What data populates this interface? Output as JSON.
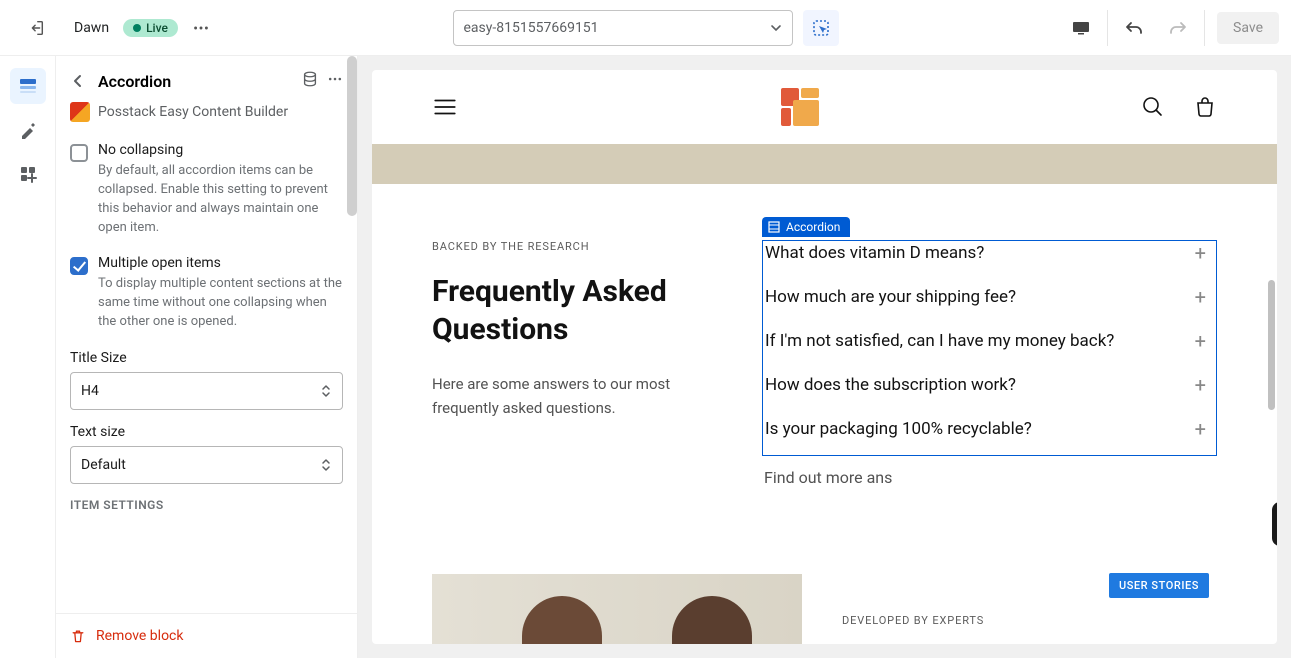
{
  "topbar": {
    "theme_name": "Dawn",
    "status_label": "Live",
    "template_name": "easy-8151557669151",
    "save_label": "Save"
  },
  "panel": {
    "title": "Accordion",
    "brand": "Posstack Easy Content Builder",
    "settings": {
      "no_collapsing": {
        "title": "No collapsing",
        "desc": "By default, all accordion items can be collapsed. Enable this setting to prevent this behavior and always maintain one open item.",
        "checked": false
      },
      "multiple_open": {
        "title": "Multiple open items",
        "desc": "To display multiple content sections at the same time without one collapsing when the other one is opened.",
        "checked": true
      },
      "title_size": {
        "label": "Title Size",
        "value": "H4"
      },
      "text_size": {
        "label": "Text size",
        "value": "Default"
      }
    },
    "item_settings_label": "ITEM SETTINGS",
    "remove_block_label": "Remove block"
  },
  "preview": {
    "faq": {
      "eyebrow": "BACKED BY THE RESEARCH",
      "title": "Frequently Asked Questions",
      "intro": "Here are some answers to our most frequently asked questions.",
      "chip_label": "Accordion",
      "items": [
        "What does vitamin D means?",
        "How much are your shipping fee?",
        "If I'm not satisfied, can I have my money back?",
        "How does the subscription work?",
        "Is your packaging 100% recyclable?"
      ],
      "find_more": "Find out more ans"
    },
    "user_stories_label": "USER STORIES",
    "experts_eyebrow": "DEVELOPED BY EXPERTS"
  },
  "colors": {
    "primary_blue": "#005bd3",
    "danger": "#d72c0d"
  }
}
